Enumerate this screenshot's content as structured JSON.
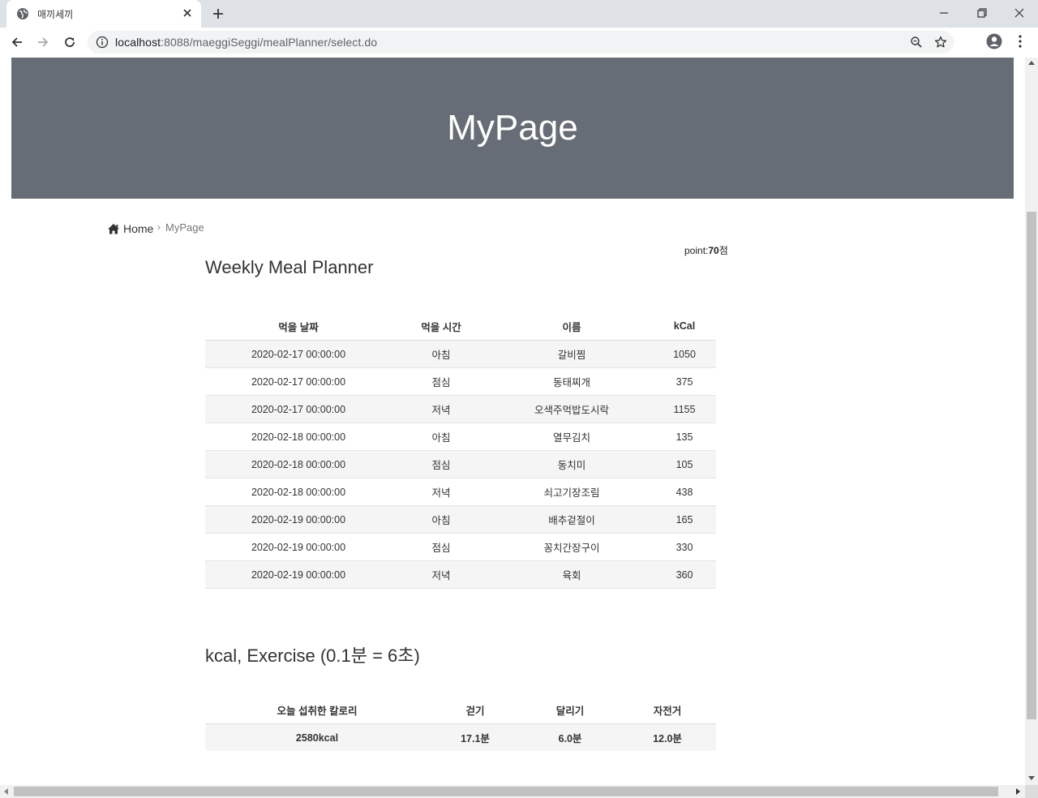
{
  "browser": {
    "tab_title": "매끼세끼",
    "url_host": "localhost",
    "url_rest": ":8088/maeggiSeggi/mealPlanner/select.do"
  },
  "hero": {
    "title": "MyPage"
  },
  "breadcrumb": {
    "home": "Home",
    "separator": "›",
    "current": "MyPage"
  },
  "point": {
    "label": "point:",
    "value": "70",
    "unit": "점"
  },
  "planner": {
    "title": "Weekly Meal Planner",
    "headers": [
      "먹을 날짜",
      "먹을 시간",
      "이름",
      "kCal"
    ],
    "rows": [
      [
        "2020-02-17 00:00:00",
        "아침",
        "갈비찜",
        "1050"
      ],
      [
        "2020-02-17 00:00:00",
        "점심",
        "동태찌개",
        "375"
      ],
      [
        "2020-02-17 00:00:00",
        "저녁",
        "오색주먹밥도시락",
        "1155"
      ],
      [
        "2020-02-18 00:00:00",
        "아침",
        "열무김치",
        "135"
      ],
      [
        "2020-02-18 00:00:00",
        "점심",
        "동치미",
        "105"
      ],
      [
        "2020-02-18 00:00:00",
        "저녁",
        "쇠고기장조림",
        "438"
      ],
      [
        "2020-02-19 00:00:00",
        "아침",
        "배추겉절이",
        "165"
      ],
      [
        "2020-02-19 00:00:00",
        "점심",
        "꽁치간장구이",
        "330"
      ],
      [
        "2020-02-19 00:00:00",
        "저녁",
        "육회",
        "360"
      ]
    ]
  },
  "exercise": {
    "title": "kcal, Exercise (0.1분 = 6초)",
    "headers": [
      "오늘 섭취한 칼로리",
      "걷기",
      "달리기",
      "자전거"
    ],
    "row": [
      "2580kcal",
      "17.1분",
      "6.0분",
      "12.0분"
    ]
  },
  "colors": {
    "hero_bg": "#676d76",
    "odd_row": "#f5f5f5"
  },
  "icons": [
    "globe-icon",
    "close-icon",
    "plus-icon",
    "back-icon",
    "forward-icon",
    "reload-icon",
    "info-icon",
    "zoom-icon",
    "star-icon",
    "profile-icon",
    "menu-icon",
    "home-icon"
  ]
}
